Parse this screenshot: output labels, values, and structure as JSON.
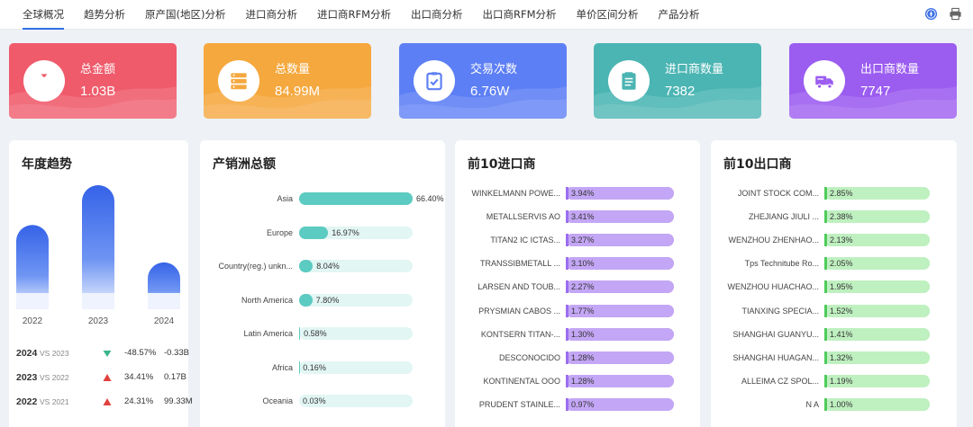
{
  "tabs": [
    "全球概况",
    "趋势分析",
    "原产国(地区)分析",
    "进口商分析",
    "进口商RFM分析",
    "出口商分析",
    "出口商RFM分析",
    "单价区间分析",
    "产品分析"
  ],
  "active_tab": 0,
  "toolbar_icons": [
    "compass-icon",
    "printer-icon"
  ],
  "kpis": [
    {
      "label": "总金额",
      "value": "1.03B",
      "icon": "money-bag-icon",
      "color": "#ef5b6b"
    },
    {
      "label": "总数量",
      "value": "84.99M",
      "icon": "database-icon",
      "color": "#f5a83e"
    },
    {
      "label": "交易次数",
      "value": "6.76W",
      "icon": "clipboard-check-icon",
      "color": "#5d7ff5"
    },
    {
      "label": "进口商数量",
      "value": "7382",
      "icon": "document-list-icon",
      "color": "#4bb5b3"
    },
    {
      "label": "出口商数量",
      "value": "7747",
      "icon": "truck-icon",
      "color": "#9b5cf0"
    }
  ],
  "panels": {
    "yearly": {
      "title": "年度趋势"
    },
    "continent": {
      "title": "产销洲总额"
    },
    "importers": {
      "title": "前10进口商"
    },
    "exporters": {
      "title": "前10出口商"
    }
  },
  "yearly_chart": {
    "type": "bar",
    "categories": [
      "2022",
      "2023",
      "2024"
    ],
    "values": [
      0.36,
      0.53,
      0.2
    ]
  },
  "comparisons": [
    {
      "year": "2024",
      "vs": "VS 2023",
      "direction": "down",
      "pct": "-48.57%",
      "diff": "-0.33B",
      "color": "#3db58a"
    },
    {
      "year": "2023",
      "vs": "VS 2022",
      "direction": "up",
      "pct": "34.41%",
      "diff": "0.17B",
      "color": "#e0403c"
    },
    {
      "year": "2022",
      "vs": "VS 2021",
      "direction": "up",
      "pct": "24.31%",
      "diff": "99.33M",
      "color": "#e0403c"
    }
  ],
  "continents": [
    {
      "name": "Asia",
      "pct": "66.40%",
      "value": 66.4
    },
    {
      "name": "Europe",
      "pct": "16.97%",
      "value": 16.97
    },
    {
      "name": "Country(reg.) unkn...",
      "pct": "8.04%",
      "value": 8.04
    },
    {
      "name": "North America",
      "pct": "7.80%",
      "value": 7.8
    },
    {
      "name": "Latin America",
      "pct": "0.58%",
      "value": 0.58
    },
    {
      "name": "Africa",
      "pct": "0.16%",
      "value": 0.16
    },
    {
      "name": "Oceania",
      "pct": "0.03%",
      "value": 0.03
    }
  ],
  "importers": [
    {
      "name": "WINKELMANN POWE...",
      "pct": "3.94%",
      "value": 3.94
    },
    {
      "name": "METALLSERVIS AO",
      "pct": "3.41%",
      "value": 3.41
    },
    {
      "name": "TITAN2 IC ICTAS...",
      "pct": "3.27%",
      "value": 3.27
    },
    {
      "name": "TRANSSIBMETALL ...",
      "pct": "3.10%",
      "value": 3.1
    },
    {
      "name": "LARSEN AND TOUB...",
      "pct": "2.27%",
      "value": 2.27
    },
    {
      "name": "PRYSMIAN CABOS ...",
      "pct": "1.77%",
      "value": 1.77
    },
    {
      "name": "KONTSERN TITAN-...",
      "pct": "1.30%",
      "value": 1.3
    },
    {
      "name": "DESCONOCIDO",
      "pct": "1.28%",
      "value": 1.28
    },
    {
      "name": "KONTINENTAL OOO",
      "pct": "1.28%",
      "value": 1.28
    },
    {
      "name": "PRUDENT STAINLE...",
      "pct": "0.97%",
      "value": 0.97
    }
  ],
  "exporters": [
    {
      "name": "JOINT STOCK COM...",
      "pct": "2.85%",
      "value": 2.85
    },
    {
      "name": "ZHEJIANG JIULI ...",
      "pct": "2.38%",
      "value": 2.38
    },
    {
      "name": "WENZHOU ZHENHAO...",
      "pct": "2.13%",
      "value": 2.13
    },
    {
      "name": "Tps Technitube Ro...",
      "pct": "2.05%",
      "value": 2.05
    },
    {
      "name": "WENZHOU HUACHAO...",
      "pct": "1.95%",
      "value": 1.95
    },
    {
      "name": "TIANXING SPECIA...",
      "pct": "1.52%",
      "value": 1.52
    },
    {
      "name": "SHANGHAI GUANYU...",
      "pct": "1.41%",
      "value": 1.41
    },
    {
      "name": "SHANGHAI HUAGAN...",
      "pct": "1.32%",
      "value": 1.32
    },
    {
      "name": "ALLEIMA CZ SPOL...",
      "pct": "1.19%",
      "value": 1.19
    },
    {
      "name": "N A",
      "pct": "1.00%",
      "value": 1.0
    }
  ],
  "colors": {
    "tab_active": "#2f6fe6",
    "continent_fill": "#5ccbc1",
    "continent_track": "#e2f6f3",
    "importer_fill": "#c3a6f5",
    "importer_marker": "#9b6ef0",
    "exporter_fill": "#bff0c0",
    "exporter_marker": "#4fcb5c"
  }
}
